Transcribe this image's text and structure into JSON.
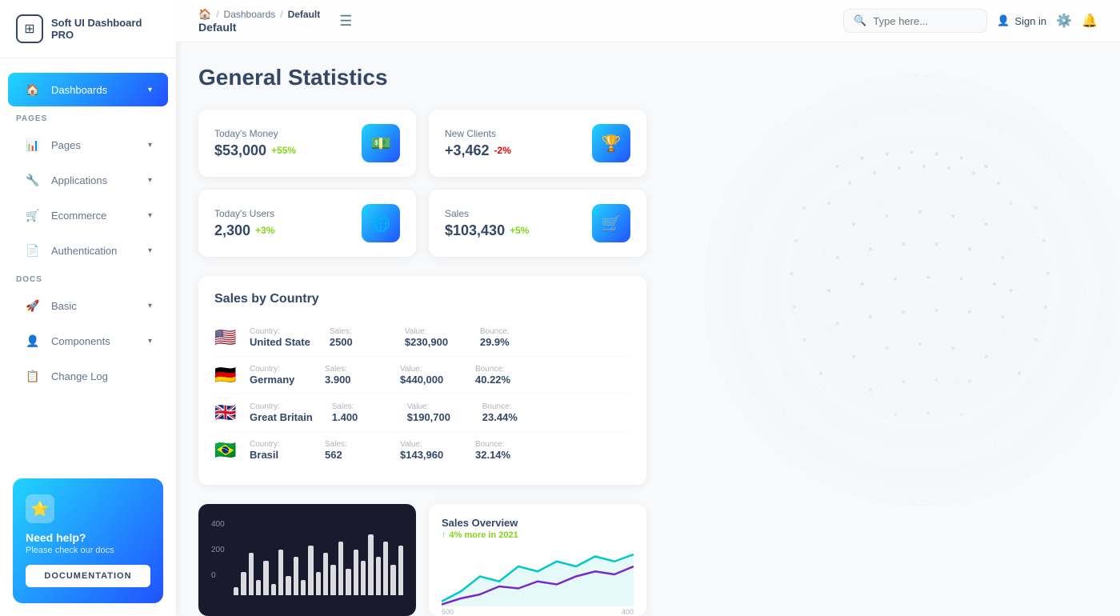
{
  "app": {
    "name": "Soft UI Dashboard PRO"
  },
  "sidebar": {
    "sections": [
      {
        "label": "PAGES",
        "items": [
          {
            "id": "dashboards",
            "label": "Dashboards",
            "icon": "🏠",
            "active": true,
            "hasChevron": true
          },
          {
            "id": "pages",
            "label": "Pages",
            "icon": "📊",
            "active": false,
            "hasChevron": true
          },
          {
            "id": "applications",
            "label": "Applications",
            "icon": "🔧",
            "active": false,
            "hasChevron": true
          },
          {
            "id": "ecommerce",
            "label": "Ecommerce",
            "icon": "🛒",
            "active": false,
            "hasChevron": true
          },
          {
            "id": "authentication",
            "label": "Authentication",
            "icon": "📄",
            "active": false,
            "hasChevron": true
          }
        ]
      },
      {
        "label": "DOCS",
        "items": [
          {
            "id": "basic",
            "label": "Basic",
            "icon": "🚀",
            "active": false,
            "hasChevron": true
          },
          {
            "id": "components",
            "label": "Components",
            "icon": "👤",
            "active": false,
            "hasChevron": true
          },
          {
            "id": "changelog",
            "label": "Change Log",
            "icon": "📋",
            "active": false,
            "hasChevron": false
          }
        ]
      }
    ],
    "help": {
      "title": "Need help?",
      "subtitle": "Please check our docs",
      "button_label": "DOCUMENTATION"
    }
  },
  "header": {
    "breadcrumb": {
      "home_icon": "🏠",
      "items": [
        "Dashboards",
        "Default"
      ]
    },
    "title": "Default",
    "search_placeholder": "Type here...",
    "sign_in_label": "Sign in",
    "hamburger": "☰"
  },
  "page": {
    "title": "General Statistics"
  },
  "stats": [
    {
      "label": "Today's Money",
      "value": "$53,000",
      "change": "+55%",
      "change_type": "pos",
      "icon": "💵",
      "icon_style": "blue"
    },
    {
      "label": "New Clients",
      "value": "+3,462",
      "change": "-2%",
      "change_type": "neg",
      "icon": "🏆",
      "icon_style": "blue"
    },
    {
      "label": "Today's Users",
      "value": "2,300",
      "change": "+3%",
      "change_type": "pos",
      "icon": "🌐",
      "icon_style": "blue"
    },
    {
      "label": "Sales",
      "value": "$103,430",
      "change": "+5%",
      "change_type": "pos",
      "icon": "🛒",
      "icon_style": "blue"
    }
  ],
  "sales_by_country": {
    "title": "Sales by Country",
    "columns": [
      "Country:",
      "Sales:",
      "Value:",
      "Bounce:"
    ],
    "rows": [
      {
        "flag": "🇺🇸",
        "country": "United State",
        "sales": "2500",
        "value": "$230,900",
        "bounce": "29.9%"
      },
      {
        "flag": "🇩🇪",
        "country": "Germany",
        "sales": "3.900",
        "value": "$440,000",
        "bounce": "40.22%"
      },
      {
        "flag": "🇬🇧",
        "country": "Great Britain",
        "sales": "1.400",
        "value": "$190,700",
        "bounce": "23.44%"
      },
      {
        "flag": "🇧🇷",
        "country": "Brasil",
        "sales": "562",
        "value": "$143,960",
        "bounce": "32.14%"
      }
    ]
  },
  "bar_chart": {
    "y_labels": [
      "400",
      "200",
      "0"
    ],
    "bars": [
      10,
      30,
      55,
      20,
      45,
      15,
      60,
      25,
      50,
      20,
      65,
      30,
      55,
      40,
      70,
      35,
      60,
      45,
      80,
      50,
      70,
      40,
      65
    ]
  },
  "sales_overview": {
    "title": "Sales Overview",
    "subtitle": "4% more in 2021",
    "y_labels": [
      "500",
      "400"
    ]
  }
}
